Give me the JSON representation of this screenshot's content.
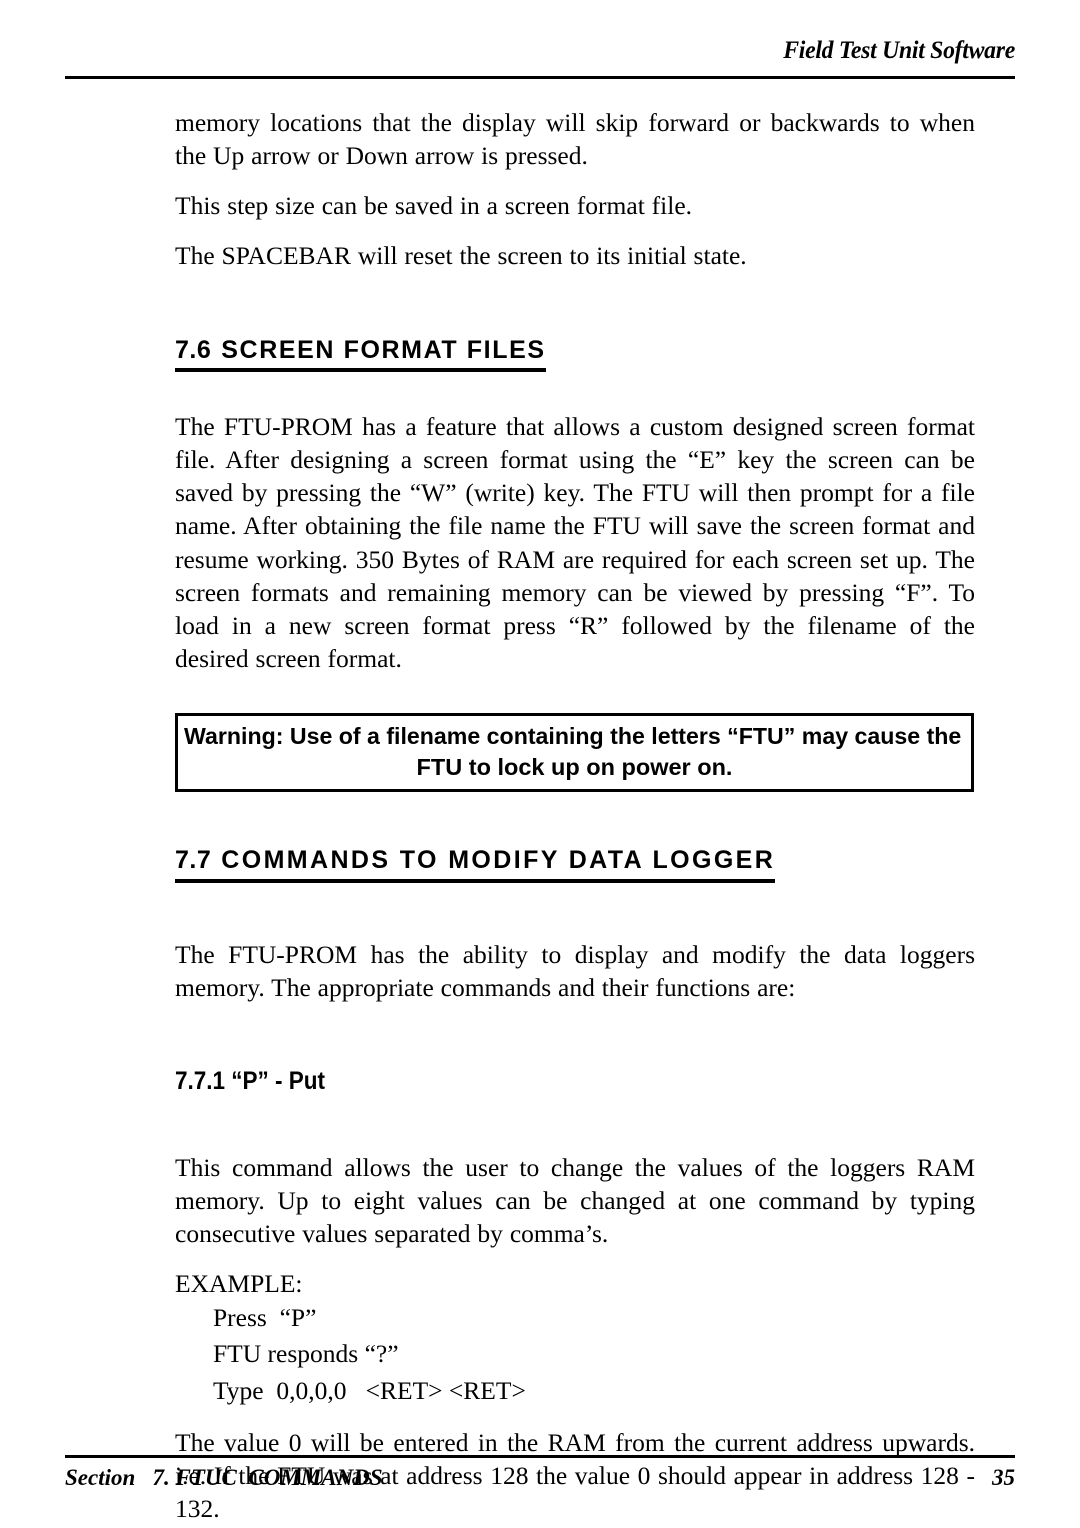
{
  "header": {
    "title": "Field Test Unit Software"
  },
  "body": {
    "paragraph_1": "memory locations that the display will skip forward or backwards to when the Up arrow or Down arrow is pressed.",
    "paragraph_2": "This step size can be saved in a screen format file.",
    "paragraph_3": "The SPACEBAR will reset the screen to its initial state."
  },
  "section_7_6": {
    "number": "7.6",
    "title": "SCREEN  FORMAT  FILES",
    "paragraph": "The FTU-PROM has a feature that allows a custom designed screen format file. After designing a screen format using the “E” key the screen can be saved by pressing the “W” (write) key. The FTU will then prompt for a file name. After obtaining the file name the FTU  will save the screen format and resume working. 350 Bytes of RAM are required for each screen set up. The screen formats and remaining memory can be viewed by pressing “F”. To load in a new screen format press “R” followed by the filename of the desired screen   format."
  },
  "warning": {
    "line_1": "Warning: Use of a filename containing the letters “FTU” may cause the",
    "line_2": "FTU to lock up on power on."
  },
  "section_7_7": {
    "number": "7.7",
    "title": "COMMANDS TO MODIFY DATA LOGGER",
    "paragraph": "The FTU-PROM  has the ability to display and modify the data loggers memory. The appropriate commands and their functions are:"
  },
  "section_7_7_1": {
    "heading": "7.7.1 “P” - Put",
    "paragraph": "This command allows the user to change the values of the loggers RAM memory. Up to eight values can be changed at one command by typing consecutive values separated by comma’s.",
    "example_label": "EXAMPLE:",
    "example_steps": [
      "Press  “P”",
      "FTU responds “?”",
      "Type  0,0,0,0   <RET> <RET>"
    ],
    "closing_paragraph": "The value 0 will be entered in the RAM from the current address upwards. i.e. If the FTU  was at address 128  the value 0 should appear in address 128 - 132."
  },
  "footer": {
    "left": "Section   7. FTUC  COMMANDS",
    "page_number": "35"
  }
}
